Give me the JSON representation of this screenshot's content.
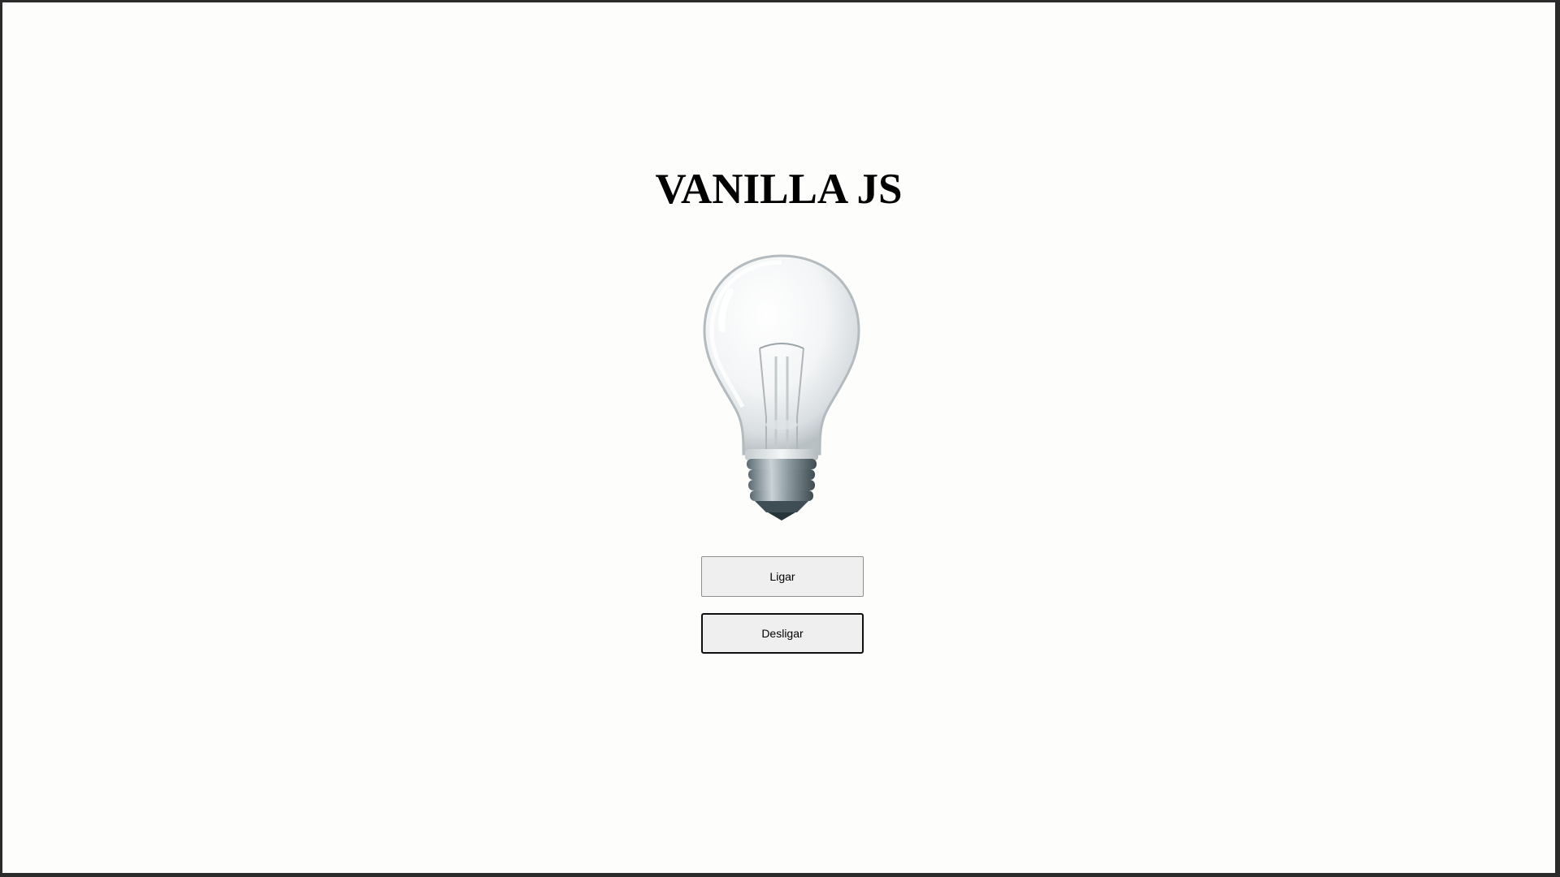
{
  "page": {
    "title": "VANILLA JS"
  },
  "bulb": {
    "state": "off",
    "icon": "lightbulb-icon"
  },
  "buttons": {
    "on_label": "Ligar",
    "off_label": "Desligar"
  },
  "colors": {
    "background": "#fdfdfb",
    "frame": "#2b2b2b",
    "button_bg": "#efefef"
  }
}
